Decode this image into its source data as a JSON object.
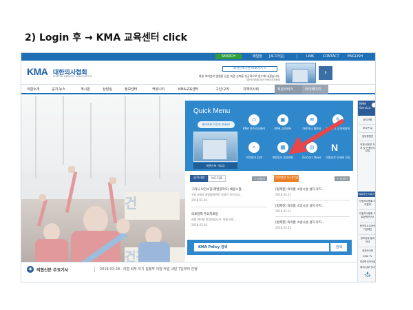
{
  "slide": {
    "title": "2) Login 후 → KMA 교육센터 click"
  },
  "utility": {
    "search_label": "SEARCH",
    "items": [
      "매일정",
      "[로그아웃]",
      "LINK",
      "CONTACT",
      "ENGLISH"
    ]
  },
  "logo": {
    "mark": "KMA",
    "name_ko": "대한의사협회",
    "name_en": "KOREAN MEDICAL ASSOCIATION"
  },
  "banner": {
    "title": "회관신축기본 바로가기 >",
    "text": "회원 여러분의 염원을 담은 회관 신축을 성공적으로 완수해 내겠습니다.",
    "sub": "대한의사협회 회관신축추진위원회"
  },
  "nav": {
    "items": [
      "의협소개",
      "공지·뉴스",
      "게시판",
      "상담실",
      "정보센터",
      "커뮤니티",
      "KMA교육센터",
      "구인/구직",
      "지역의사회",
      "회원서비스",
      "마이페이지"
    ]
  },
  "quick_menu": {
    "title": "Quick Menu",
    "subtitle": "편리하게 이것저 보세요!",
    "photo_label": "회관신축 기부금",
    "items": [
      {
        "label": "KMA 연수인공센터",
        "icon": "monitor-icon"
      },
      {
        "label": "KMA 교육센터",
        "icon": "book-icon"
      },
      {
        "label": "대한의사 협회지",
        "icon": "journal-icon"
      },
      {
        "label": "의료광고 심의위원회",
        "icon": "chat-icon"
      },
      {
        "label": "의학용어 검색",
        "icon": "search-doc-icon"
      },
      {
        "label": "회원증서 증명센터",
        "icon": "certificate-icon"
      },
      {
        "label": "Doctors News",
        "icon": "globe-icon"
      },
      {
        "label": "의협신문 인쇄비 모집",
        "icon": "n-icon"
      }
    ]
  },
  "notice_left": {
    "tab1": "공지사항",
    "tab2": "보도자료",
    "more": "+ 더보기",
    "items": [
      {
        "title": "구리시 보건소장(계명창작모) 채용시험...",
        "text": "구리시에서 개방형직위로 의료인 보건소장...",
        "date": "2018.03.26"
      },
      {
        "title": "의료정책 주요자료형",
        "text": "회원 여러분 안녕하십니까. 의협 의료...",
        "date": "2018.03.28"
      }
    ]
  },
  "notice_right": {
    "tab1": "의료법령 모니터링",
    "more": "+ 더보기",
    "items": [
      {
        "title": "[법제정] 의약품 소방시설 설치·유지...",
        "date": "2018.03.21"
      },
      {
        "title": "[법제정] 의약품 소방시설 설치·유지...",
        "date": "2018.03.21"
      },
      {
        "title": "[법제정] 의약품 소방시설 설치·유지...",
        "date": "2018.03.21"
      }
    ]
  },
  "policy": {
    "placeholder": "KMA Policy 검색",
    "button": "검색"
  },
  "side": {
    "title": "KMA Service",
    "items": [
      "공지사항",
      "보시판 길",
      "담당행정편",
      "의협 내외부 자치 및 인증비서 모집",
      "대한의사협회 대외협력",
      "대한의사협회 의료정책연구소",
      "한국의사100년 기념재단",
      "대한의사협회 의료정책연구소",
      "정보공유 열쇠 안내",
      "세계의사회",
      "KMA TV",
      "의료박석관사업",
      "회비 납부 안내"
    ],
    "shortcut": "바로가기 서비스 ▸",
    "top": "TOP"
  },
  "ticker": {
    "label": "의협신문 주요기사",
    "text": "2018-03-28 · 의협 회무 차기 집행부 이양 작업 내달 7일부터 진행"
  }
}
